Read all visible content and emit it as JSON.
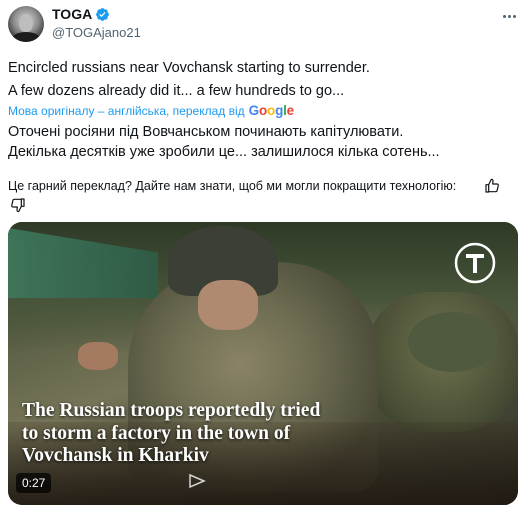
{
  "author": {
    "display_name": "TOGA",
    "handle": "@TOGAjano21",
    "verified": true,
    "verified_color": "#1d9bf0"
  },
  "post": {
    "lines": [
      "Encircled russians near Vovchansk starting to surrender.",
      "A few dozens already did it... a few hundreds to go..."
    ]
  },
  "translation": {
    "label": "Мова оригіналу – англійська, переклад від",
    "provider": {
      "g1": "G",
      "o1": "o",
      "o2": "o",
      "g2": "g",
      "l": "l",
      "e": "e"
    },
    "lines": [
      "Оточені росіяни під Вовчанськом починають капітулювати.",
      "Декілька десятків уже зробили це... залишилося кілька сотень..."
    ],
    "feedback": "Це гарний переклад? Дайте нам знати, щоб ми могли покращити технологію:"
  },
  "media": {
    "caption_lines": [
      "The Russian troops reportedly tried",
      "to storm a factory in the town of",
      "Vovchansk in Kharkiv"
    ],
    "duration": "0:27"
  },
  "icons": {
    "more": "more-icon",
    "verified": "verified-badge-icon",
    "thumbs_up": "thumbs-up-icon",
    "thumbs_down": "thumbs-down-icon",
    "publisher_logo": "publisher-logo-icon"
  },
  "colors": {
    "link": "#1d9bf0",
    "text": "#0f1419",
    "secondary": "#536471"
  }
}
